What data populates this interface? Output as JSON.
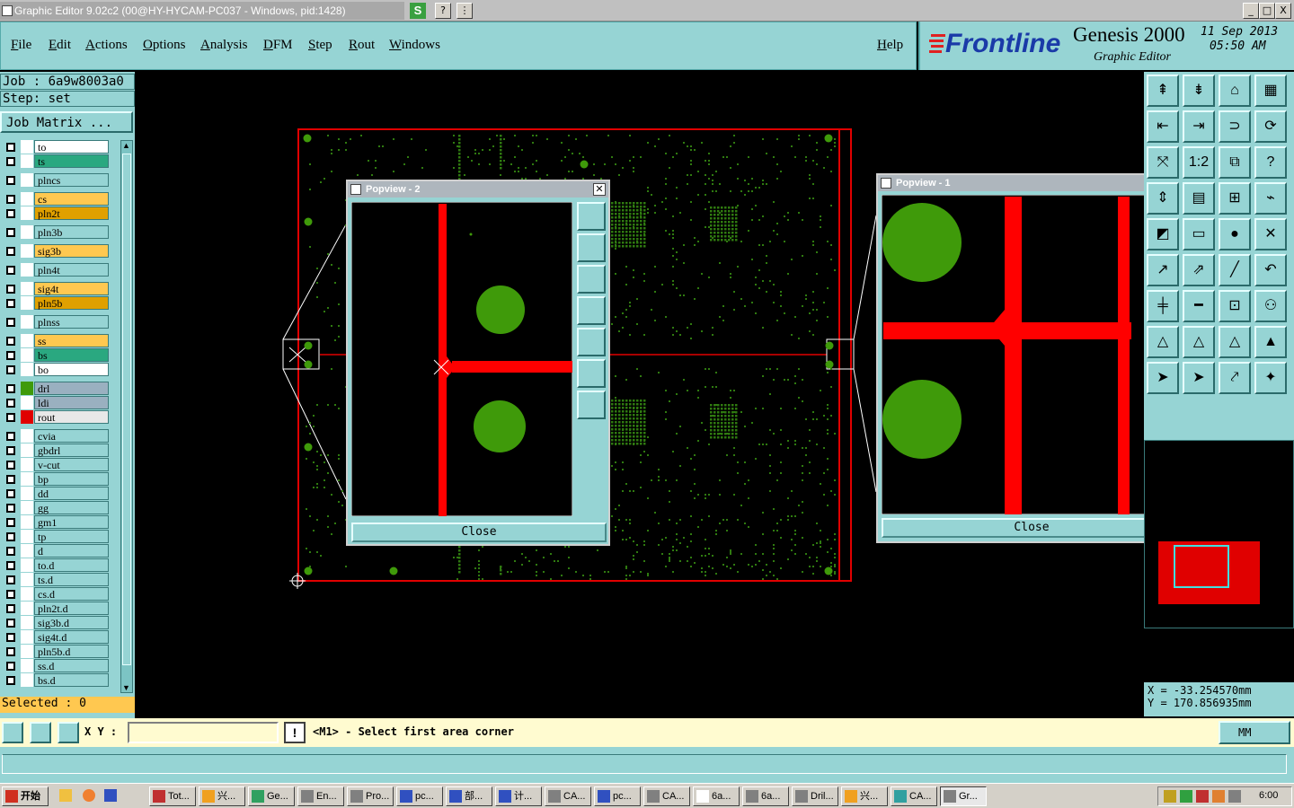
{
  "window": {
    "title": "Graphic Editor 9.02c2 (00@HY-HYCAM-PC037 - Windows, pid:1428)",
    "controls": [
      "_",
      "□",
      "X"
    ]
  },
  "menu": {
    "items": [
      "File",
      "Edit",
      "Actions",
      "Options",
      "Analysis",
      "DFM",
      "Step",
      "Rout",
      "Windows"
    ],
    "help": "Help"
  },
  "branding": {
    "logo": "Frontline",
    "product": "Genesis 2000",
    "subtitle": "Graphic Editor",
    "date": "11 Sep 2013",
    "time": "05:50 AM"
  },
  "job": {
    "job_label": "Job : 6a9w8003a0",
    "step_label": "Step: set",
    "matrix_button": "Job Matrix ..."
  },
  "layers": [
    {
      "name": "to",
      "color": "#ffffff"
    },
    {
      "name": "ts",
      "color": "#2aa880"
    },
    {
      "name": "plncs",
      "color": "#96d4d4"
    },
    {
      "name": "cs",
      "color": "#ffc850"
    },
    {
      "name": "pln2t",
      "color": "#e0a000"
    },
    {
      "name": "pln3b",
      "color": "#96d4d4"
    },
    {
      "name": "sig3b",
      "color": "#ffc850"
    },
    {
      "name": "pln4t",
      "color": "#96d4d4"
    },
    {
      "name": "sig4t",
      "color": "#ffc850"
    },
    {
      "name": "pln5b",
      "color": "#e0a000"
    },
    {
      "name": "plnss",
      "color": "#96d4d4"
    },
    {
      "name": "ss",
      "color": "#ffc850"
    },
    {
      "name": "bs",
      "color": "#2aa880"
    },
    {
      "name": "bo",
      "color": "#ffffff"
    },
    {
      "name": "drl",
      "color": "#9ab0c0"
    },
    {
      "name": "ldi",
      "color": "#9ab0c0"
    },
    {
      "name": "rout",
      "color": "#e8e8e8"
    },
    {
      "name": "cvia",
      "color": "#96d4d4"
    },
    {
      "name": "gbdrl",
      "color": "#96d4d4"
    },
    {
      "name": "v-cut",
      "color": "#96d4d4"
    },
    {
      "name": "bp",
      "color": "#96d4d4"
    },
    {
      "name": "dd",
      "color": "#96d4d4"
    },
    {
      "name": "gg",
      "color": "#96d4d4"
    },
    {
      "name": "gm1",
      "color": "#96d4d4"
    },
    {
      "name": "tp",
      "color": "#96d4d4"
    },
    {
      "name": "d",
      "color": "#96d4d4"
    },
    {
      "name": "to.d",
      "color": "#96d4d4"
    },
    {
      "name": "ts.d",
      "color": "#96d4d4"
    },
    {
      "name": "cs.d",
      "color": "#96d4d4"
    },
    {
      "name": "pln2t.d",
      "color": "#96d4d4"
    },
    {
      "name": "sig3b.d",
      "color": "#96d4d4"
    },
    {
      "name": "sig4t.d",
      "color": "#96d4d4"
    },
    {
      "name": "pln5b.d",
      "color": "#96d4d4"
    },
    {
      "name": "ss.d",
      "color": "#96d4d4"
    },
    {
      "name": "bs.d",
      "color": "#96d4d4"
    }
  ],
  "selected": "Selected : 0",
  "popview2": {
    "title": "Popview - 2",
    "close": "Close"
  },
  "popview1": {
    "title": "Popview - 1",
    "close": "Close"
  },
  "coords": {
    "x": "X  =  -33.254570mm",
    "y": "Y  =  170.856935mm"
  },
  "status": {
    "xy_label": "X Y :",
    "xy_value": "",
    "prompt": "<M1> - Select first area corner",
    "units": "MM"
  },
  "taskbar": {
    "start": "开始",
    "tasks": [
      "Tot...",
      "兴...",
      "Ge...",
      "En...",
      "Pro...",
      "pc...",
      "部...",
      "计...",
      "CA...",
      "pc...",
      "CA...",
      "6a...",
      "6a...",
      "Dril...",
      "兴...",
      "CA...",
      "Gr..."
    ],
    "clock": "6:00"
  },
  "colors": {
    "teal": "#96d4d4",
    "trace": "#ff0000",
    "pad": "#3f9a0a",
    "board_dots": "#3a8a10"
  }
}
